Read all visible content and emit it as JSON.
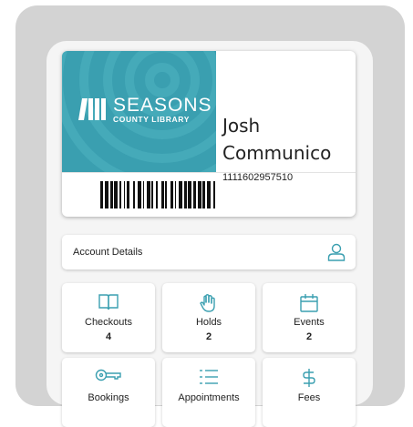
{
  "card": {
    "library_name_line1": "SEASONS",
    "library_name_line2": "COUNTY LIBRARY",
    "first_name": "Josh",
    "last_name": "Communico",
    "card_number": "1111602957510",
    "brand_color": "#3a9fb0"
  },
  "account": {
    "label": "Account Details",
    "icon": "person-icon"
  },
  "tiles": [
    {
      "label": "Checkouts",
      "count": "4",
      "icon": "book-icon"
    },
    {
      "label": "Holds",
      "count": "2",
      "icon": "hand-icon"
    },
    {
      "label": "Events",
      "count": "2",
      "icon": "calendar-icon"
    },
    {
      "label": "Bookings",
      "icon": "key-icon"
    },
    {
      "label": "Appointments",
      "icon": "list-icon"
    },
    {
      "label": "Fees",
      "icon": "dollar-icon"
    }
  ],
  "accent_color": "#3a9fb0"
}
